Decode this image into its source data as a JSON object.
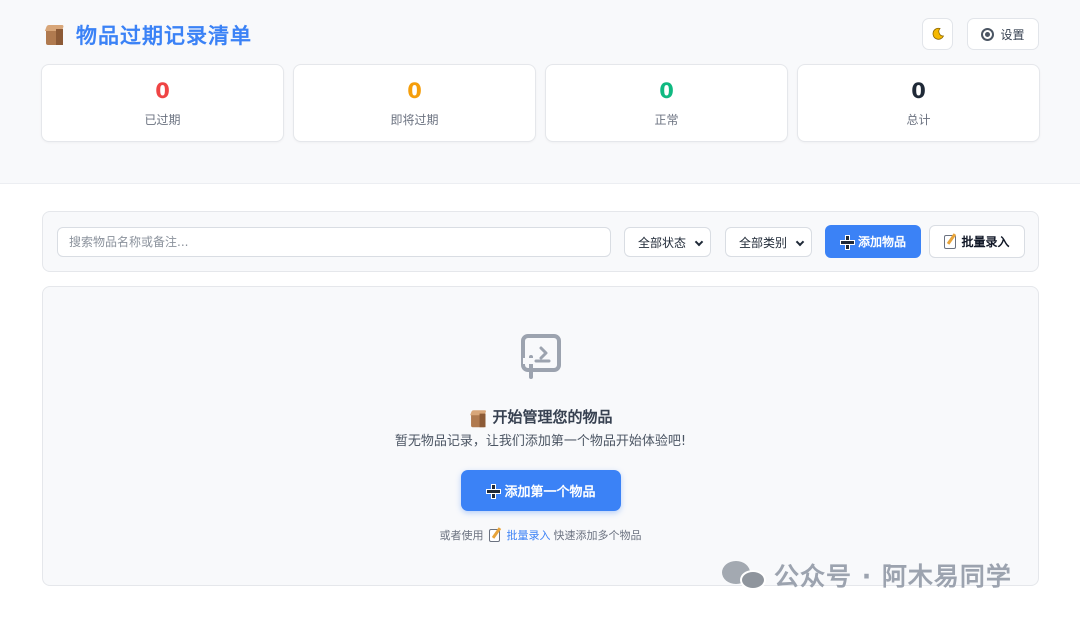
{
  "header": {
    "title": "物品过期记录清单",
    "title_icon": "package-icon",
    "theme_icon": "moon-icon",
    "settings_label": "设置"
  },
  "stats": [
    {
      "value": "0",
      "label": "已过期",
      "color": "#ef4444"
    },
    {
      "value": "0",
      "label": "即将过期",
      "color": "#f59e0b"
    },
    {
      "value": "0",
      "label": "正常",
      "color": "#10b981"
    },
    {
      "value": "0",
      "label": "总计",
      "color": "#1f2937"
    }
  ],
  "toolbar": {
    "search_placeholder": "搜索物品名称或备注...",
    "status_filter": "全部状态",
    "category_filter": "全部类别",
    "add_label": "添加物品",
    "batch_label": "批量录入"
  },
  "empty_state": {
    "icon": "empty-box-icon",
    "title": "开始管理您的物品",
    "description": "暂无物品记录，让我们添加第一个物品开始体验吧!",
    "button_label": "添加第一个物品",
    "hint_prefix": "或者使用",
    "hint_link": "批量录入",
    "hint_suffix": "快速添加多个物品"
  },
  "watermark": {
    "text": "公众号 · 阿木易同学"
  },
  "colors": {
    "accent": "#3b82f6",
    "expired": "#ef4444",
    "expiring": "#f59e0b",
    "normal": "#10b981"
  }
}
